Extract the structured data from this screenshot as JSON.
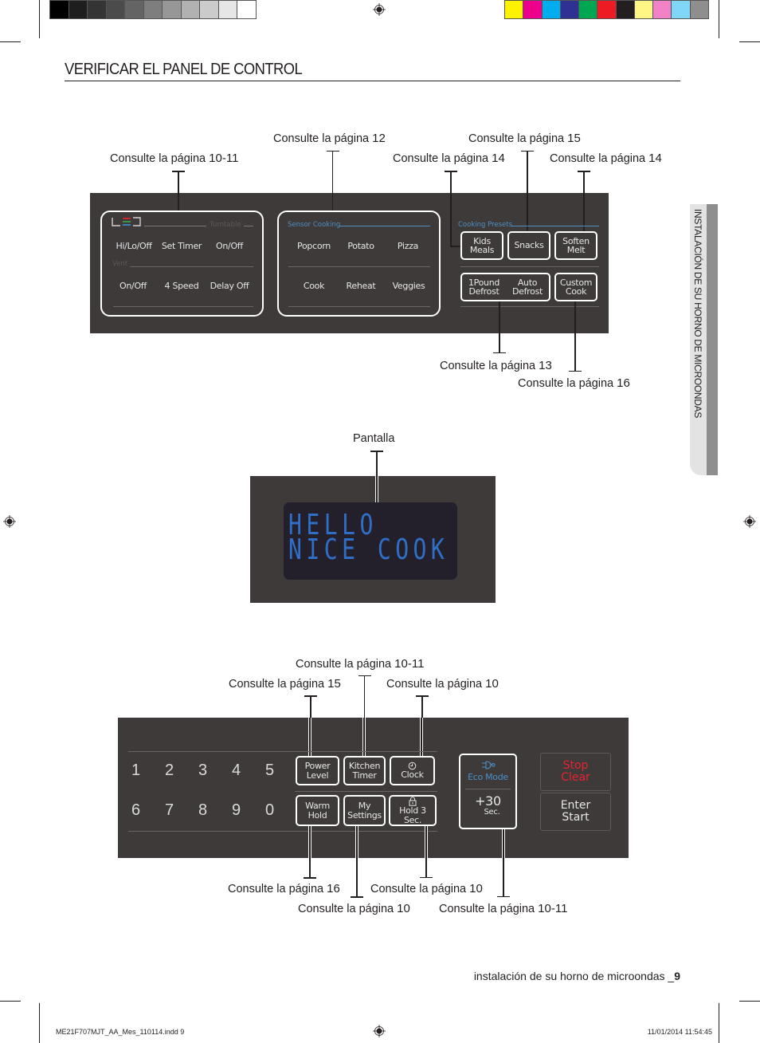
{
  "print_marks": {
    "grayscale_swatches": [
      "#000000",
      "#1e1e1e",
      "#343434",
      "#4b4b4b",
      "#646464",
      "#7e7e7e",
      "#979797",
      "#b1b1b1",
      "#cbcbcb",
      "#e6e6e6",
      "#ffffff"
    ],
    "color_swatches": [
      "#fff200",
      "#ec008c",
      "#00aeef",
      "#2e3192",
      "#00a651",
      "#ed1c24",
      "#231f20",
      "#fff685",
      "#f282c7",
      "#7fd6f7",
      "#8e8e8e"
    ]
  },
  "page": {
    "title": "VERIFICAR EL PANEL DE CONTROL",
    "side_tab": "INSTALACIÓN DE SU HORNO DE MICROONDAS",
    "footer": {
      "text": "instalación de su horno de microondas _",
      "page_number": "9"
    },
    "file_info": "ME21F707MJT_AA_Mes_110114.indd   9",
    "timestamp": "11/01/2014   11:54:45"
  },
  "callout_prefix": "Consulte la página",
  "top_callouts": [
    {
      "id": "led-group",
      "page": "10-11"
    },
    {
      "id": "sensor-cooking",
      "page": "12"
    },
    {
      "id": "kids-meals",
      "page": "14"
    },
    {
      "id": "snacks",
      "page": "15"
    },
    {
      "id": "soften-melt",
      "page": "14"
    },
    {
      "id": "defrost",
      "page": "13"
    },
    {
      "id": "custom-cook",
      "page": "16"
    }
  ],
  "panel_top": {
    "led_group": {
      "led_label": "LED",
      "turntable_label": "Turntable",
      "vent_label": "Vent",
      "row1": [
        "Hi/Lo/Off",
        "Set Timer",
        "On/Off"
      ],
      "row2": [
        "On/Off",
        "4 Speed",
        "Delay Off"
      ]
    },
    "sensor_group": {
      "label": "Sensor Cooking",
      "row1": [
        "Popcorn",
        "Potato",
        "Pizza"
      ],
      "row2": [
        "Cook",
        "Reheat",
        "Veggies"
      ]
    },
    "presets": {
      "label": "Cooking Presets",
      "kids_meals": [
        "Kids",
        "Meals"
      ],
      "snacks": "Snacks",
      "soften_melt": [
        "Soften",
        "Melt"
      ],
      "pound_defrost": [
        "1Pound",
        "Defrost"
      ],
      "auto_defrost": [
        "Auto",
        "Defrost"
      ],
      "custom_cook": [
        "Custom",
        "Cook"
      ]
    },
    "accent_color": "#4a8fc4"
  },
  "display": {
    "label": "Pantalla",
    "line1": "HELLO",
    "line2": "NICE COOK",
    "text_color": "#2f6fc7"
  },
  "bottom_callouts": [
    {
      "id": "kitchen-timer",
      "page": "10-11"
    },
    {
      "id": "power-level",
      "page": "15"
    },
    {
      "id": "clock",
      "page": "10"
    },
    {
      "id": "warm-hold",
      "page": "16"
    },
    {
      "id": "my-settings",
      "page": "10"
    },
    {
      "id": "hold-3-sec",
      "page": "10"
    },
    {
      "id": "plus-30",
      "page": "10-11"
    }
  ],
  "panel_bottom": {
    "digits_row1": [
      "1",
      "2",
      "3",
      "4",
      "5"
    ],
    "digits_row2": [
      "6",
      "7",
      "8",
      "9",
      "0"
    ],
    "power_level": [
      "Power",
      "Level"
    ],
    "kitchen_timer": [
      "Kitchen",
      "Timer"
    ],
    "clock": "Clock",
    "warm_hold": [
      "Warm",
      "Hold"
    ],
    "my_settings": [
      "My",
      "Settings"
    ],
    "hold_3_sec": "Hold 3 Sec.",
    "eco_mode": "Eco Mode",
    "plus30": [
      "+30",
      "Sec."
    ],
    "stop_clear": [
      "Stop",
      "Clear"
    ],
    "enter_start": [
      "Enter",
      "Start"
    ],
    "stop_color": "#e8232f",
    "eco_color": "#4a8fc4"
  }
}
